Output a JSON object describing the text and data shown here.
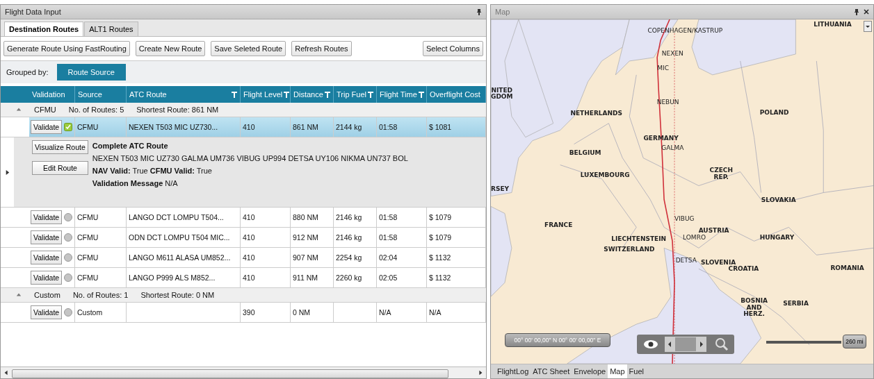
{
  "flight_data_panel": {
    "title": "Flight Data Input",
    "tabs": [
      {
        "label": "Destination Routes",
        "selected": true
      },
      {
        "label": "ALT1 Routes",
        "selected": false
      }
    ],
    "actions": [
      "Generate Route Using FastRouting",
      "Create New Route",
      "Save Seleted Route",
      "Refresh Routes"
    ],
    "select_columns": "Select Columns",
    "grouped_by": {
      "label": "Grouped by:",
      "chip": "Route Source"
    },
    "columns": [
      {
        "label": "Validation",
        "filter": false
      },
      {
        "label": "Source",
        "filter": false
      },
      {
        "label": "ATC Route",
        "filter": true
      },
      {
        "label": "Flight Level",
        "filter": true
      },
      {
        "label": "Distance",
        "filter": true
      },
      {
        "label": "Trip Fuel",
        "filter": true
      },
      {
        "label": "Flight Time",
        "filter": true
      },
      {
        "label": "Overflight Cost",
        "filter": false
      }
    ],
    "groups": [
      {
        "name": "CFMU",
        "expanded": true,
        "count": "No. of Routes: 5",
        "shortest": "Shortest Route: 861 NM",
        "rows": [
          {
            "button": "Validate",
            "validated": true,
            "selected": true,
            "cells": [
              "CFMU",
              "NEXEN T503 MIC UZ730...",
              "410",
              "861 NM",
              "2144 kg",
              "01:58",
              "$ 1081"
            ],
            "detail": {
              "visualize": "Visualize Route",
              "edit": "Edit Route",
              "heading": "Complete ATC Route",
              "route": "NEXEN T503 MIC UZ730 GALMA UM736 VIBUG UP994 DETSA UY106 NIKMA UN737 BOL",
              "valid_line": "**NAV Valid:** True **CFMU Valid:** True",
              "message_line": "**Validation Message** N/A"
            }
          },
          {
            "button": "Validate",
            "validated": false,
            "selected": false,
            "cells": [
              "CFMU",
              "LANGO DCT LOMPU T504...",
              "410",
              "880 NM",
              "2146 kg",
              "01:58",
              "$ 1079"
            ]
          },
          {
            "button": "Validate",
            "validated": false,
            "selected": false,
            "cells": [
              "CFMU",
              "ODN DCT LOMPU T504 MIC...",
              "410",
              "912 NM",
              "2146 kg",
              "01:58",
              "$ 1079"
            ]
          },
          {
            "button": "Validate",
            "validated": false,
            "selected": false,
            "cells": [
              "CFMU",
              "LANGO M611 ALASA UM852...",
              "410",
              "907 NM",
              "2254 kg",
              "02:04",
              "$ 1132"
            ]
          },
          {
            "button": "Validate",
            "validated": false,
            "selected": false,
            "cells": [
              "CFMU",
              "LANGO P999 ALS M852...",
              "410",
              "911 NM",
              "2260 kg",
              "02:05",
              "$ 1132"
            ]
          }
        ]
      },
      {
        "name": "Custom",
        "expanded": true,
        "count": "No. of Routes: 1",
        "shortest": "Shortest Route: 0 NM",
        "rows": [
          {
            "button": "Validate",
            "validated": false,
            "selected": false,
            "cells": [
              "Custom",
              "",
              "390",
              "0 NM",
              "",
              "N/A",
              "N/A"
            ]
          }
        ]
      }
    ]
  },
  "map_panel": {
    "title": "Map",
    "labels": [
      {
        "text": "COPENHAGEN/KASTRUP",
        "kind": "waypoint"
      },
      {
        "text": "LITHUANIA",
        "kind": "country"
      },
      {
        "text": "NEXEN",
        "kind": "waypoint"
      },
      {
        "text": "MIC",
        "kind": "waypoint"
      },
      {
        "text": "NITED\nGDOM",
        "kind": "country"
      },
      {
        "text": "NEBUN",
        "kind": "waypoint"
      },
      {
        "text": "NETHERLANDS",
        "kind": "country"
      },
      {
        "text": "POLAND",
        "kind": "country"
      },
      {
        "text": "GERMANY",
        "kind": "country"
      },
      {
        "text": "GALMA",
        "kind": "waypoint"
      },
      {
        "text": "BELGIUM",
        "kind": "country"
      },
      {
        "text": "LUXEMBOURG",
        "kind": "country"
      },
      {
        "text": "CZECH\nREP.",
        "kind": "country"
      },
      {
        "text": "RSEY",
        "kind": "country"
      },
      {
        "text": "SLOVAKIA",
        "kind": "country"
      },
      {
        "text": "FRANCE",
        "kind": "country"
      },
      {
        "text": "VIBUG",
        "kind": "waypoint"
      },
      {
        "text": "AUSTRIA",
        "kind": "country"
      },
      {
        "text": "LIECHTENSTEIN",
        "kind": "country"
      },
      {
        "text": "LOMRO",
        "kind": "waypoint"
      },
      {
        "text": "HUNGARY",
        "kind": "country"
      },
      {
        "text": "SWITZERLAND",
        "kind": "country"
      },
      {
        "text": "DETSA",
        "kind": "waypoint"
      },
      {
        "text": "SLOVENIA",
        "kind": "country"
      },
      {
        "text": "CROATIA",
        "kind": "country"
      },
      {
        "text": "ROMANIA",
        "kind": "country"
      },
      {
        "text": "BOSNIA\nAND\nHERZ.",
        "kind": "country"
      },
      {
        "text": "SERBIA",
        "kind": "country"
      }
    ],
    "coordinates": "00° 00' 00,00\" N 00° 00' 00,00\" E",
    "scale": "260 mi",
    "tabs": [
      {
        "label": "FlightLog",
        "selected": false
      },
      {
        "label": "ATC Sheet",
        "selected": false
      },
      {
        "label": "Envelope",
        "selected": false
      },
      {
        "label": "Map",
        "selected": true
      },
      {
        "label": "Fuel",
        "selected": false
      }
    ]
  }
}
